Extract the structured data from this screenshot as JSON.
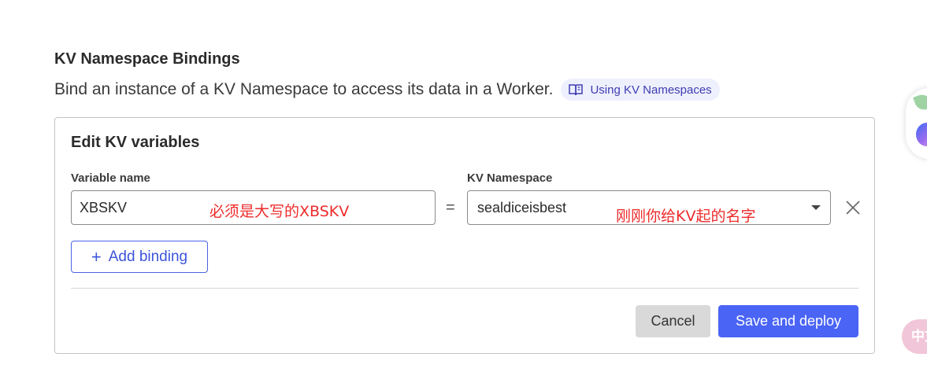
{
  "header": {
    "title": "KV Namespace Bindings",
    "description": "Bind an instance of a KV Namespace to access its data in a Worker.",
    "doc_link_label": "Using KV Namespaces"
  },
  "card": {
    "title": "Edit KV variables",
    "variable_label": "Variable name",
    "variable_value": "XBSKV",
    "variable_annotation": "必须是大写的XBSKV",
    "equals": "=",
    "namespace_label": "KV Namespace",
    "namespace_value": "sealdiceisbest",
    "namespace_annotation": "刚刚你给KV起的名字",
    "add_binding_label": "Add binding",
    "add_binding_icon": "+",
    "cancel_label": "Cancel",
    "save_label": "Save and deploy"
  },
  "floating": {
    "pink_label": "中文"
  },
  "icons": {
    "doc": "book-icon",
    "plus": "plus-icon",
    "caret": "chevron-down-icon",
    "remove": "close-icon"
  },
  "colors": {
    "primary": "#4a64f5",
    "link_bg": "#eef0fe",
    "link_text": "#3e3cb3",
    "annotation": "#ee2b2b",
    "cancel_bg": "#d9d9d9"
  }
}
